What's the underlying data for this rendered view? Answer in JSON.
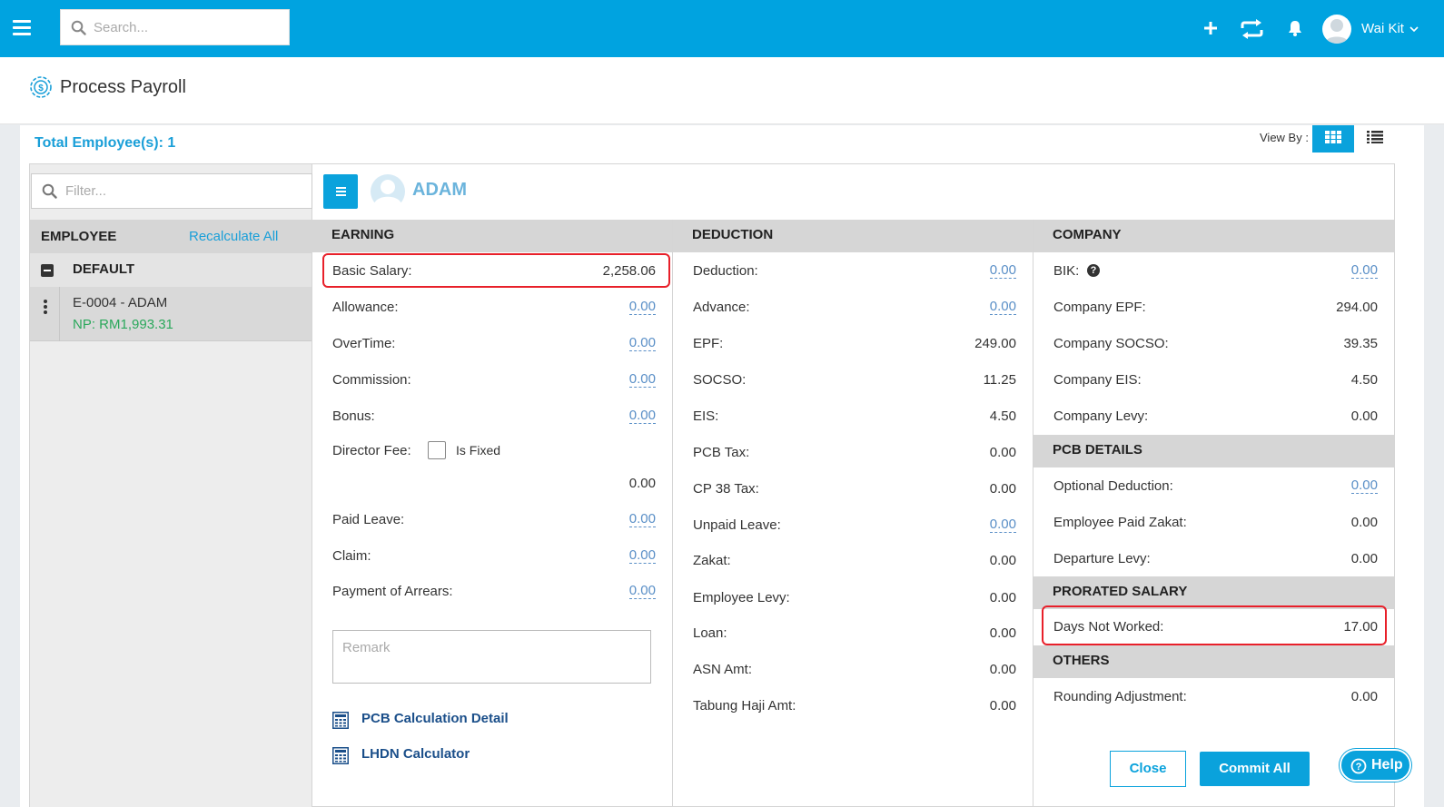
{
  "topbar": {
    "search_placeholder": "Search...",
    "user_name": "Wai Kit",
    "brand_color": "#00a3e0"
  },
  "page": {
    "title": "Process Payroll"
  },
  "summary": {
    "total_employees": "Total Employee(s): 1",
    "view_by_label": "View By :"
  },
  "employee_panel": {
    "filter_placeholder": "Filter...",
    "header_label": "EMPLOYEE",
    "recalculate_label": "Recalculate All",
    "group_name": "DEFAULT",
    "employee_code": "E-0004 - ADAM",
    "net_pay": "NP: RM1,993.31"
  },
  "selected_employee": {
    "name": "ADAM"
  },
  "earning": {
    "header": "EARNING",
    "rows": [
      {
        "label": "Basic Salary:",
        "value": "2,258.06"
      },
      {
        "label": "Allowance:",
        "value": "0.00"
      },
      {
        "label": "OverTime:",
        "value": "0.00"
      },
      {
        "label": "Commission:",
        "value": "0.00"
      },
      {
        "label": "Bonus:",
        "value": "0.00"
      },
      {
        "label": "Director Fee:",
        "value": "0.00"
      },
      {
        "label": "Paid Leave:",
        "value": "0.00"
      },
      {
        "label": "Claim:",
        "value": "0.00"
      },
      {
        "label": "Payment of Arrears:",
        "value": "0.00"
      }
    ],
    "is_fixed_label": "Is Fixed",
    "remark_placeholder": "Remark",
    "pcb_link": "PCB Calculation Detail",
    "lhdn_link": "LHDN Calculator"
  },
  "deduction": {
    "header": "DEDUCTION",
    "rows": [
      {
        "label": "Deduction:",
        "value": "0.00"
      },
      {
        "label": "Advance:",
        "value": "0.00"
      },
      {
        "label": "EPF:",
        "value": "249.00"
      },
      {
        "label": "SOCSO:",
        "value": "11.25"
      },
      {
        "label": "EIS:",
        "value": "4.50"
      },
      {
        "label": "PCB Tax:",
        "value": "0.00"
      },
      {
        "label": "CP 38 Tax:",
        "value": "0.00"
      },
      {
        "label": "Unpaid Leave:",
        "value": "0.00"
      },
      {
        "label": "Zakat:",
        "value": "0.00"
      },
      {
        "label": "Employee Levy:",
        "value": "0.00"
      },
      {
        "label": "Loan:",
        "value": "0.00"
      },
      {
        "label": "ASN Amt:",
        "value": "0.00"
      },
      {
        "label": "Tabung Haji Amt:",
        "value": "0.00"
      }
    ]
  },
  "company": {
    "header": "COMPANY",
    "rows": [
      {
        "label": "BIK:",
        "value": "0.00"
      },
      {
        "label": "Company EPF:",
        "value": "294.00"
      },
      {
        "label": "Company SOCSO:",
        "value": "39.35"
      },
      {
        "label": "Company EIS:",
        "value": "4.50"
      },
      {
        "label": "Company Levy:",
        "value": "0.00"
      }
    ],
    "pcb_header": "PCB DETAILS",
    "pcb_rows": [
      {
        "label": "Optional Deduction:",
        "value": "0.00"
      },
      {
        "label": "Employee Paid Zakat:",
        "value": "0.00"
      },
      {
        "label": "Departure Levy:",
        "value": "0.00"
      }
    ],
    "prorated_header": "PRORATED SALARY",
    "prorated_rows": [
      {
        "label": "Days Not Worked:",
        "value": "17.00"
      }
    ],
    "others_header": "OTHERS",
    "others_rows": [
      {
        "label": "Rounding Adjustment:",
        "value": "0.00"
      }
    ]
  },
  "actions": {
    "close_label": "Close",
    "commit_label": "Commit All",
    "help_label": "Help"
  },
  "icons": [
    "menu-icon",
    "search-icon",
    "plus-icon",
    "sync-icon",
    "bell-icon",
    "user-avatar-icon",
    "chevron-down-icon",
    "payroll-icon",
    "grid-view-icon",
    "list-view-icon",
    "calculator-icon",
    "question-icon",
    "help-icon"
  ]
}
